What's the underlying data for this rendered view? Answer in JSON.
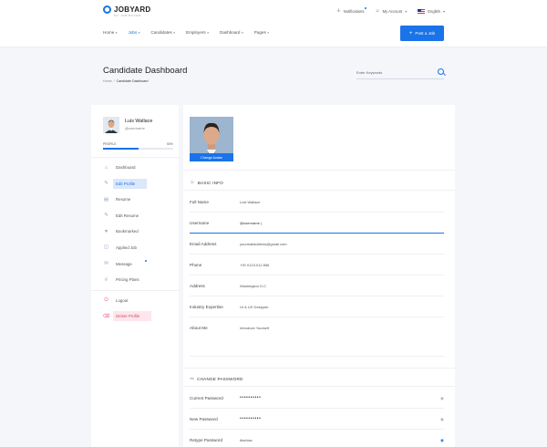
{
  "brand": {
    "name": "JOBYARD",
    "tagline": "MY JOB BOARD"
  },
  "topbar": {
    "notifications": "Notifications",
    "account": "My Account",
    "language": "English"
  },
  "nav": [
    {
      "label": "Home"
    },
    {
      "label": "Jobs"
    },
    {
      "label": "Candidates"
    },
    {
      "label": "Employers"
    },
    {
      "label": "Dashboard"
    },
    {
      "label": "Pages"
    }
  ],
  "post_job": "Post a Job",
  "page": {
    "title": "Candidate Dashboard",
    "crumb_home": "Home",
    "crumb_sep": "/",
    "crumb_current": "Candidate Dashboard"
  },
  "search": {
    "placeholder": "Enter Keywords"
  },
  "profile": {
    "name": "Luis Wallace",
    "username": "@username",
    "progress_label": "PROFILE",
    "progress_text": "50%",
    "progress": 0.5
  },
  "menu": [
    {
      "label": "Dashboard",
      "icon": "home-icon"
    },
    {
      "label": "Edit Profile",
      "icon": "user-edit-icon"
    },
    {
      "label": "Resume",
      "icon": "resume-icon"
    },
    {
      "label": "Edit Resume",
      "icon": "edit-icon"
    },
    {
      "label": "Bookmarked",
      "icon": "heart-icon"
    },
    {
      "label": "Applied Job",
      "icon": "briefcase-icon"
    },
    {
      "label": "Message",
      "icon": "message-icon"
    },
    {
      "label": "Pricing Plans",
      "icon": "crown-icon"
    },
    {
      "label": "Logout",
      "icon": "power-icon"
    },
    {
      "label": "Delete Profile",
      "icon": "trash-icon"
    }
  ],
  "photo": {
    "button": "Change Avatar"
  },
  "basic": {
    "title": "BASIC INFO",
    "fields": [
      {
        "label": "Full Name",
        "value": "Luis Wallace"
      },
      {
        "label": "Username",
        "value": "@username |"
      },
      {
        "label": "Email Address",
        "value": "yourmailaddress@gmail.com"
      },
      {
        "label": "Phone",
        "value": "+00 0123.012.656"
      },
      {
        "label": "Address",
        "value": "Washington D.C"
      },
      {
        "label": "Industry Expertise",
        "value": "UI & UX Designer"
      },
      {
        "label": "About Me",
        "value": "Introduce Yourself"
      }
    ]
  },
  "password": {
    "title": "CHANGE PASSWORD",
    "fields": [
      {
        "label": "Current Password",
        "value": "••••••••••"
      },
      {
        "label": "New Password",
        "value": "••••••••••"
      },
      {
        "label": "Retype Password",
        "value": "tikohlas"
      }
    ]
  },
  "colors": {
    "accent": "#1a73e8",
    "danger": "#e0476d"
  }
}
